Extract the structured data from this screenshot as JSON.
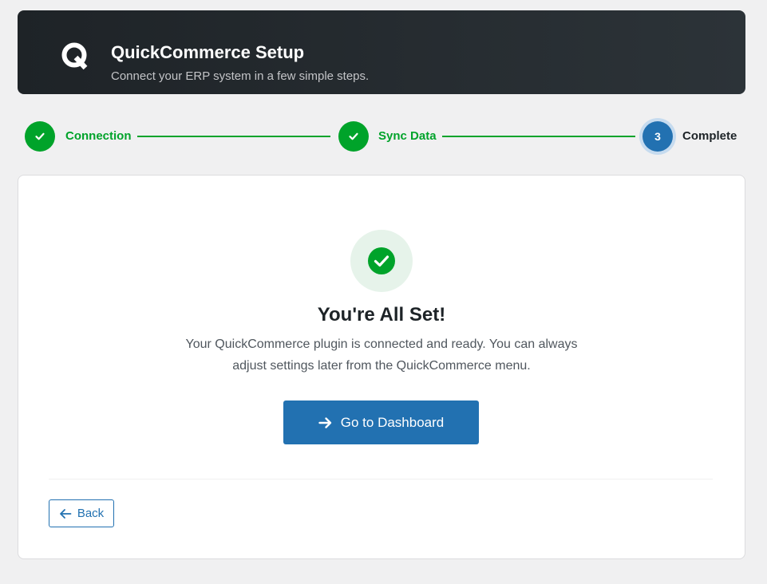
{
  "header": {
    "logo_icon": "quickcommerce-q-logo-icon",
    "title": "QuickCommerce Setup",
    "subtitle": "Connect your ERP system in a few simple steps."
  },
  "steps": [
    {
      "label": "Connection",
      "status": "completed",
      "icon": "check-icon"
    },
    {
      "label": "Sync Data",
      "status": "completed",
      "icon": "check-icon"
    },
    {
      "label": "Complete",
      "status": "current",
      "number": "3"
    }
  ],
  "main": {
    "status_icon": "check-circle-icon",
    "headline": "You're All Set!",
    "message": "Your QuickCommerce plugin is connected and ready. You can always adjust settings later from the QuickCommerce menu.",
    "primary_button": {
      "label": "Go to Dashboard",
      "icon": "arrow-right-icon"
    },
    "back_button": {
      "label": "Back",
      "icon": "arrow-left-icon"
    }
  },
  "colors": {
    "header_bg": "#1e2327",
    "success": "#00a32a",
    "accent": "#2271b1",
    "page_bg": "#f0f0f1"
  }
}
